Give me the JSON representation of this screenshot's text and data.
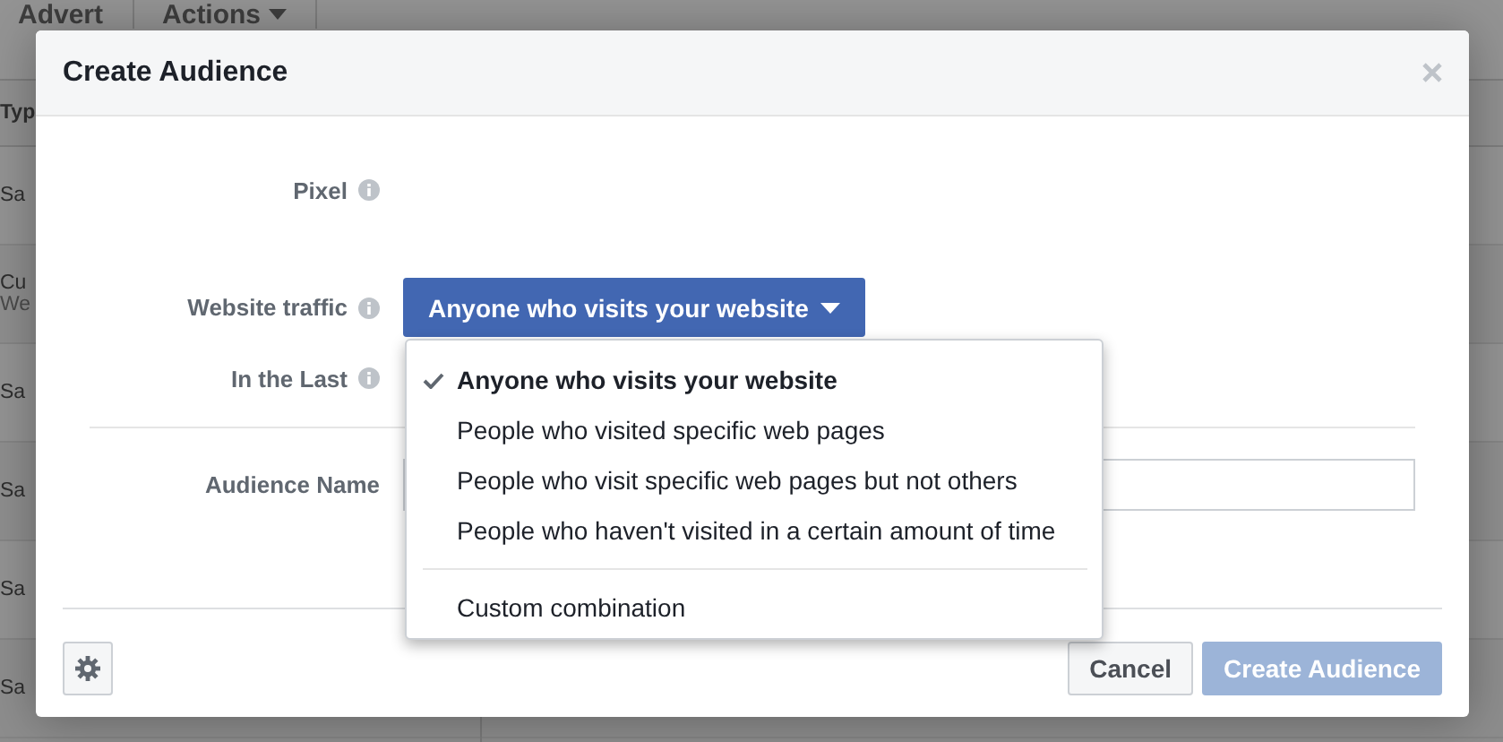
{
  "background_page": {
    "toolbar": [
      {
        "label": "Advert",
        "caret": false
      },
      {
        "label": "Actions",
        "caret": true
      }
    ],
    "table": {
      "column_1": "Typ",
      "rows": [
        {
          "lines": [
            "Sa"
          ]
        },
        {
          "lines": [
            "Cu",
            "We"
          ]
        },
        {
          "lines": [
            "Sa"
          ]
        },
        {
          "lines": [
            "Sa"
          ]
        },
        {
          "lines": [
            "Sa"
          ]
        },
        {
          "lines": [
            "Sa"
          ]
        }
      ]
    }
  },
  "dialog": {
    "title": "Create Audience",
    "fields": [
      {
        "kind": "info",
        "label": "Pixel"
      },
      {
        "kind": "dropdown",
        "label": "Website traffic",
        "value": "Anyone who visits your website",
        "expanded": true
      },
      {
        "kind": "info",
        "label": "In the Last"
      },
      {
        "kind": "text",
        "label": "Audience Name"
      }
    ],
    "menu": [
      {
        "kind": "option",
        "label": "Anyone who visits your website",
        "selected": true
      },
      {
        "kind": "option",
        "label": "People who visited specific web pages",
        "selected": false
      },
      {
        "kind": "option",
        "label": "People who visit specific web pages but not others",
        "selected": false
      },
      {
        "kind": "option",
        "label": "People who haven't visited in a certain amount of time",
        "selected": false
      },
      {
        "kind": "divider"
      },
      {
        "kind": "option",
        "label": "Custom combination",
        "selected": false
      }
    ],
    "buttons": [
      {
        "kind": "secondary",
        "label": "Cancel",
        "disabled": false
      },
      {
        "kind": "primary",
        "label": "Create Audience",
        "disabled": true
      }
    ]
  }
}
